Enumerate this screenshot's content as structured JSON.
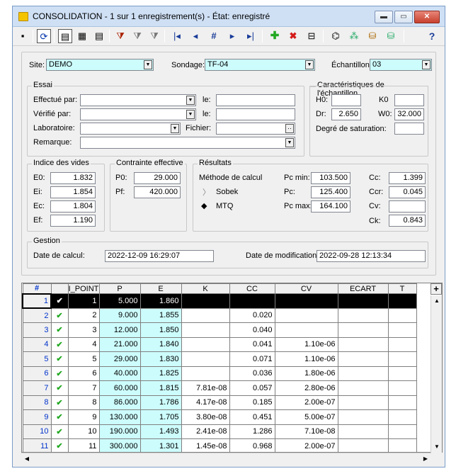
{
  "window": {
    "title": "CONSOLIDATION - 1 sur 1 enregistrement(s) - État: enregistré"
  },
  "toolbar_icons": [
    "save-icon",
    "refresh-icon",
    "form-view-icon",
    "table-view-icon",
    "list-view-icon",
    "filter-icon",
    "filter-all-icon",
    "filter-remove-icon",
    "first-record-icon",
    "previous-record-icon",
    "goto-record-icon",
    "next-record-icon",
    "last-record-icon",
    "add-record-icon",
    "delete-record-icon",
    "print-icon",
    "export-icon",
    "chart-icon",
    "graph-icon",
    "database-icon",
    "help-icon"
  ],
  "site": {
    "label": "Site:",
    "value": "DEMO"
  },
  "sondage": {
    "label": "Sondage:",
    "value": "TF-04"
  },
  "echantillon": {
    "label": "Échantillon:",
    "value": "03"
  },
  "essai": {
    "title": "Essai",
    "effectue_label": "Effectué par:",
    "effectue_value": "",
    "verifie_label": "Vérifié par:",
    "verifie_value": "",
    "laboratoire_label": "Laboratoire:",
    "laboratoire_value": "",
    "remarque_label": "Remarque:",
    "remarque_value": "",
    "le_label": "le:",
    "le1_value": "",
    "le2_value": "",
    "fichier_label": "Fichier:",
    "fichier_value": ""
  },
  "caract": {
    "title": "Caractéristiques de l'échantillon",
    "h0_label": "H0:",
    "h0_value": "",
    "k0_label": "K0",
    "k0_value": "",
    "dr_label": "Dr:",
    "dr_value": "2.650",
    "w0_label": "W0:",
    "w0_value": "32.000",
    "degre_label": "Degré de saturation:",
    "degre_value": ""
  },
  "indice": {
    "title": "Indice des vides",
    "e0_label": "E0:",
    "e0_value": "1.832",
    "ei_label": "Ei:",
    "ei_value": "1.854",
    "ec_label": "Ec:",
    "ec_value": "1.804",
    "ef_label": "Ef:",
    "ef_value": "1.190"
  },
  "contrainte": {
    "title": "Contrainte effective",
    "p0_label": "P0:",
    "p0_value": "29.000",
    "pf_label": "Pf:",
    "pf_value": "420.000"
  },
  "resultats": {
    "title": "Résultats",
    "methode_label": "Méthode de calcul",
    "sobek_label": "Sobek",
    "mtq_label": "MTQ",
    "pcmin_label": "Pc min:",
    "pcmin_value": "103.500",
    "pc_label": "Pc:",
    "pc_value": "125.400",
    "pcmax_label": "Pc max:",
    "pcmax_value": "164.100",
    "cc_label": "Cc:",
    "cc_value": "1.399",
    "ccr_label": "Ccr:",
    "ccr_value": "0.045",
    "cv_label": "Cv:",
    "cv_value": "",
    "ck_label": "Ck:",
    "ck_value": "0.843"
  },
  "gestion": {
    "title": "Gestion",
    "calcul_label": "Date de calcul:",
    "calcul_value": "2022-12-09 16:29:07",
    "modif_label": "Date de modification:",
    "modif_value": "2022-09-28 12:13:34"
  },
  "grid": {
    "headers": [
      "#",
      "",
      "I_POINT",
      "P",
      "E",
      "K",
      "CC",
      "CV",
      "ECART",
      "T"
    ],
    "rows": [
      {
        "n": "1",
        "ipoint": "1",
        "p": "5.000",
        "e": "1.860",
        "k": "",
        "cc": "",
        "cv": "",
        "ecart": "",
        "t": ""
      },
      {
        "n": "2",
        "ipoint": "2",
        "p": "9.000",
        "e": "1.855",
        "k": "",
        "cc": "0.020",
        "cv": "",
        "ecart": "",
        "t": ""
      },
      {
        "n": "3",
        "ipoint": "3",
        "p": "12.000",
        "e": "1.850",
        "k": "",
        "cc": "0.040",
        "cv": "",
        "ecart": "",
        "t": ""
      },
      {
        "n": "4",
        "ipoint": "4",
        "p": "21.000",
        "e": "1.840",
        "k": "",
        "cc": "0.041",
        "cv": "1.10e-06",
        "ecart": "",
        "t": ""
      },
      {
        "n": "5",
        "ipoint": "5",
        "p": "29.000",
        "e": "1.830",
        "k": "",
        "cc": "0.071",
        "cv": "1.10e-06",
        "ecart": "",
        "t": ""
      },
      {
        "n": "6",
        "ipoint": "6",
        "p": "40.000",
        "e": "1.825",
        "k": "",
        "cc": "0.036",
        "cv": "1.80e-06",
        "ecart": "",
        "t": ""
      },
      {
        "n": "7",
        "ipoint": "7",
        "p": "60.000",
        "e": "1.815",
        "k": "7.81e-08",
        "cc": "0.057",
        "cv": "2.80e-06",
        "ecart": "",
        "t": ""
      },
      {
        "n": "8",
        "ipoint": "8",
        "p": "86.000",
        "e": "1.786",
        "k": "4.17e-08",
        "cc": "0.185",
        "cv": "2.00e-07",
        "ecart": "",
        "t": ""
      },
      {
        "n": "9",
        "ipoint": "9",
        "p": "130.000",
        "e": "1.705",
        "k": "3.80e-08",
        "cc": "0.451",
        "cv": "5.00e-07",
        "ecart": "",
        "t": ""
      },
      {
        "n": "10",
        "ipoint": "10",
        "p": "190.000",
        "e": "1.493",
        "k": "2.41e-08",
        "cc": "1.286",
        "cv": "7.10e-08",
        "ecart": "",
        "t": ""
      },
      {
        "n": "11",
        "ipoint": "11",
        "p": "300.000",
        "e": "1.301",
        "k": "1.45e-08",
        "cc": "0.968",
        "cv": "2.00e-07",
        "ecart": "",
        "t": ""
      }
    ],
    "plus_label": "+"
  }
}
